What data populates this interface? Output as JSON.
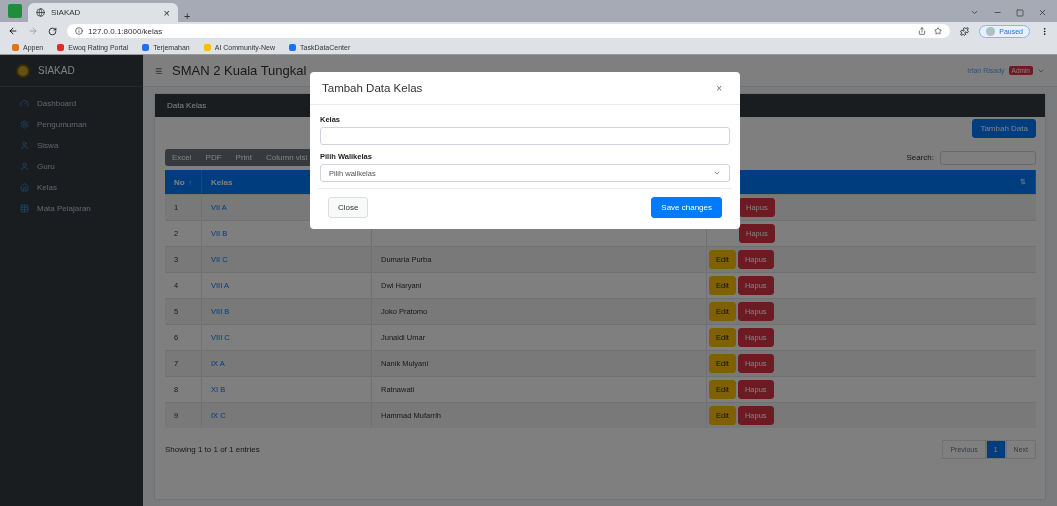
{
  "browser": {
    "tab_title": "SIAKAD",
    "tab_close": "×",
    "new_tab": "+",
    "url": "127.0.0.1:8000/kelas",
    "bookmarks": [
      "Appen",
      "Ewoq Rating Portal",
      "Terjemahan",
      "AI Community-New",
      "TaskDataCenter"
    ],
    "profile": "Paused"
  },
  "sidebar": {
    "brand": "SIAKAD",
    "items": [
      {
        "label": "Dashboard"
      },
      {
        "label": "Pengumuman"
      },
      {
        "label": "Siswa"
      },
      {
        "label": "Guru"
      },
      {
        "label": "Kelas"
      },
      {
        "label": "Mata Pelajaran"
      }
    ]
  },
  "header": {
    "menu": "≡",
    "title": "SMAN 2 Kuala Tungkal",
    "user": "Irfan Risady",
    "role": "Admin"
  },
  "card": {
    "title": "Data Kelas",
    "add_button": "Tambah Data",
    "export_buttons": [
      "Excel",
      "PDF",
      "Print",
      "Column visi"
    ],
    "search_label": "Search:",
    "columns": [
      {
        "label": "No",
        "sort": "↑"
      },
      {
        "label": "Kelas"
      },
      {},
      {
        "sort": "⇅"
      }
    ],
    "rows": [
      {
        "no": "1",
        "kelas": "VII A",
        "actions": [
          {
            "label": "Hapus",
            "kind": "danger"
          }
        ]
      },
      {
        "no": "2",
        "kelas": "VII B",
        "actions": [
          {
            "label": "Hapus",
            "kind": "danger"
          }
        ]
      },
      {
        "no": "3",
        "kelas": "VII C",
        "walikelas": "Dumaria Purba",
        "actions": [
          {
            "label": "Edit",
            "kind": "warning"
          },
          {
            "label": "Hapus",
            "kind": "danger"
          }
        ]
      },
      {
        "no": "4",
        "kelas": "VIII A",
        "walikelas": "Dwi Haryani",
        "actions": [
          {
            "label": "Edit",
            "kind": "warning"
          },
          {
            "label": "Hapus",
            "kind": "danger"
          }
        ]
      },
      {
        "no": "5",
        "kelas": "VIII B",
        "walikelas": "Joko Pratomo",
        "actions": [
          {
            "label": "Edit",
            "kind": "warning"
          },
          {
            "label": "Hapus",
            "kind": "danger"
          }
        ]
      },
      {
        "no": "6",
        "kelas": "VIII C",
        "walikelas": "Junaidi Umar",
        "actions": [
          {
            "label": "Edit",
            "kind": "warning"
          },
          {
            "label": "Hapus",
            "kind": "danger"
          }
        ]
      },
      {
        "no": "7",
        "kelas": "IX A",
        "walikelas": "Nanik Mulyani",
        "actions": [
          {
            "label": "Edit",
            "kind": "warning"
          },
          {
            "label": "Hapus",
            "kind": "danger"
          }
        ]
      },
      {
        "no": "8",
        "kelas": "XI B",
        "walikelas": "Ratnawati",
        "actions": [
          {
            "label": "Edit",
            "kind": "warning"
          },
          {
            "label": "Hapus",
            "kind": "danger"
          }
        ]
      },
      {
        "no": "9",
        "kelas": "IX C",
        "walikelas": "Hammad Mufarrih",
        "actions": [
          {
            "label": "Edit",
            "kind": "warning"
          },
          {
            "label": "Hapus",
            "kind": "danger"
          }
        ]
      }
    ],
    "info": "Showing 1 to 1 of 1 entries",
    "pagination": {
      "previous": "Previous",
      "pages": [
        {
          "label": "1",
          "selected": true
        }
      ],
      "next": "Next"
    }
  },
  "modal": {
    "title": "Tambah Data Kelas",
    "close": "×",
    "fields": [
      {
        "kind": "text",
        "label": "Kelas"
      },
      {
        "kind": "select",
        "label": "Pilih Walikelas",
        "value": "Pilih walikelas"
      }
    ],
    "buttons": [
      {
        "kind": "secondary",
        "label": "Close"
      },
      {
        "kind": "primary",
        "label": "Save changes"
      }
    ]
  }
}
